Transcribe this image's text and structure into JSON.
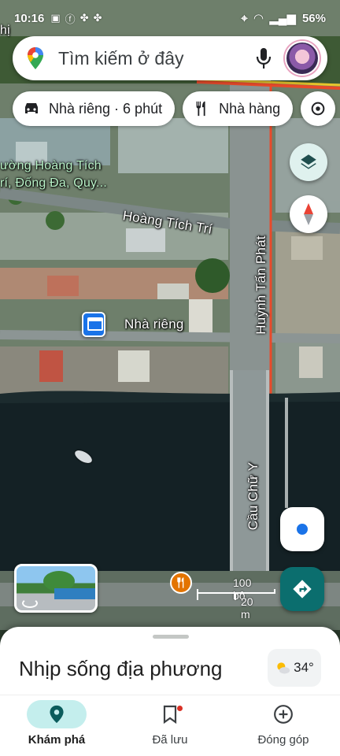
{
  "status_bar": {
    "time": "10:16",
    "notification_icons": [
      "photo-icon",
      "facebook-icon",
      "pinwheel-icon",
      "pinwheel-icon"
    ],
    "right_icons": [
      "location-icon",
      "wifi-icon",
      "lte-signal-icon"
    ],
    "battery": "56%"
  },
  "search": {
    "placeholder": "Tìm kiếm ở đây",
    "left_icon": "google-maps-pin-icon",
    "mic_icon": "microphone-icon",
    "avatar": "profile-avatar"
  },
  "chips": [
    {
      "label": "Nhà riêng · 6 phút",
      "icon": "car-icon"
    },
    {
      "label": "Nhà hàng",
      "icon": "fork-knife-icon"
    },
    {
      "label": "",
      "icon": "more-places-icon"
    }
  ],
  "map": {
    "labels": {
      "ward": "ường Hoàng Tích\nrí, Đống Đa, Quy...",
      "top_edge": "hị",
      "street_1": "Hoàng Tích Trí",
      "street_2": "Huỳnh Tấn Phát",
      "bridge": "Cầu Chữ Y",
      "home": "Nhà riêng"
    },
    "accent_home": "#1a73e8",
    "route_color": "#e84a2a"
  },
  "scale": {
    "top": "100 bộ",
    "bottom": "20 m"
  },
  "sheet": {
    "title": "Nhịp sống địa phương",
    "weather_temp": "34°",
    "weather_icon": "partly-sunny-icon"
  },
  "nav": [
    {
      "label": "Khám phá",
      "icon": "explore-pin-icon",
      "active": true
    },
    {
      "label": "Đã lưu",
      "icon": "bookmark-icon",
      "active": false
    },
    {
      "label": "Đóng góp",
      "icon": "add-circle-icon",
      "active": false
    }
  ]
}
